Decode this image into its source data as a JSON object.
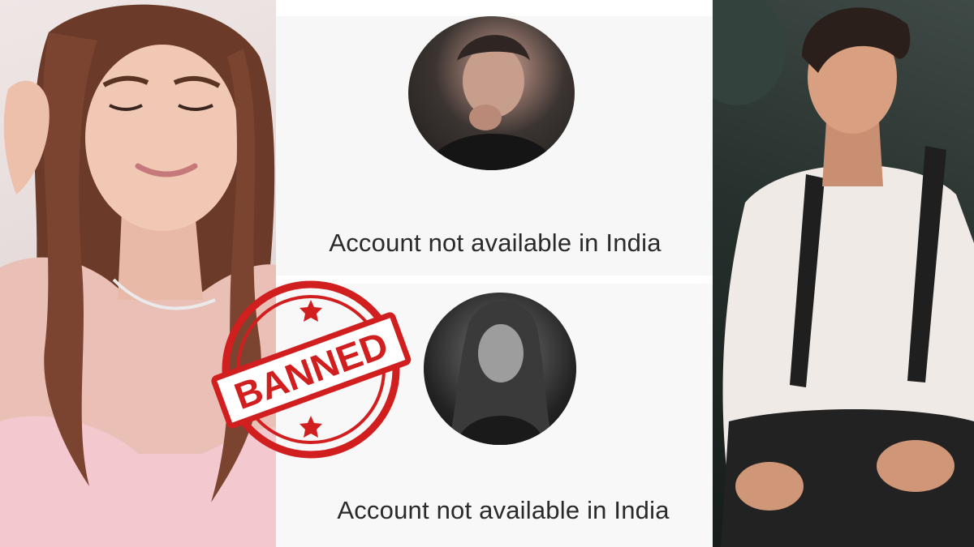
{
  "cards": [
    {
      "message": "Account not available in India",
      "avatar_icon": "profile-avatar-man"
    },
    {
      "message": "Account not available in India",
      "avatar_icon": "profile-avatar-woman"
    }
  ],
  "stamp": {
    "text": "BANNED",
    "color": "#d11f1f"
  },
  "colors": {
    "background": "#ffffff",
    "text": "#2a2a2a"
  }
}
